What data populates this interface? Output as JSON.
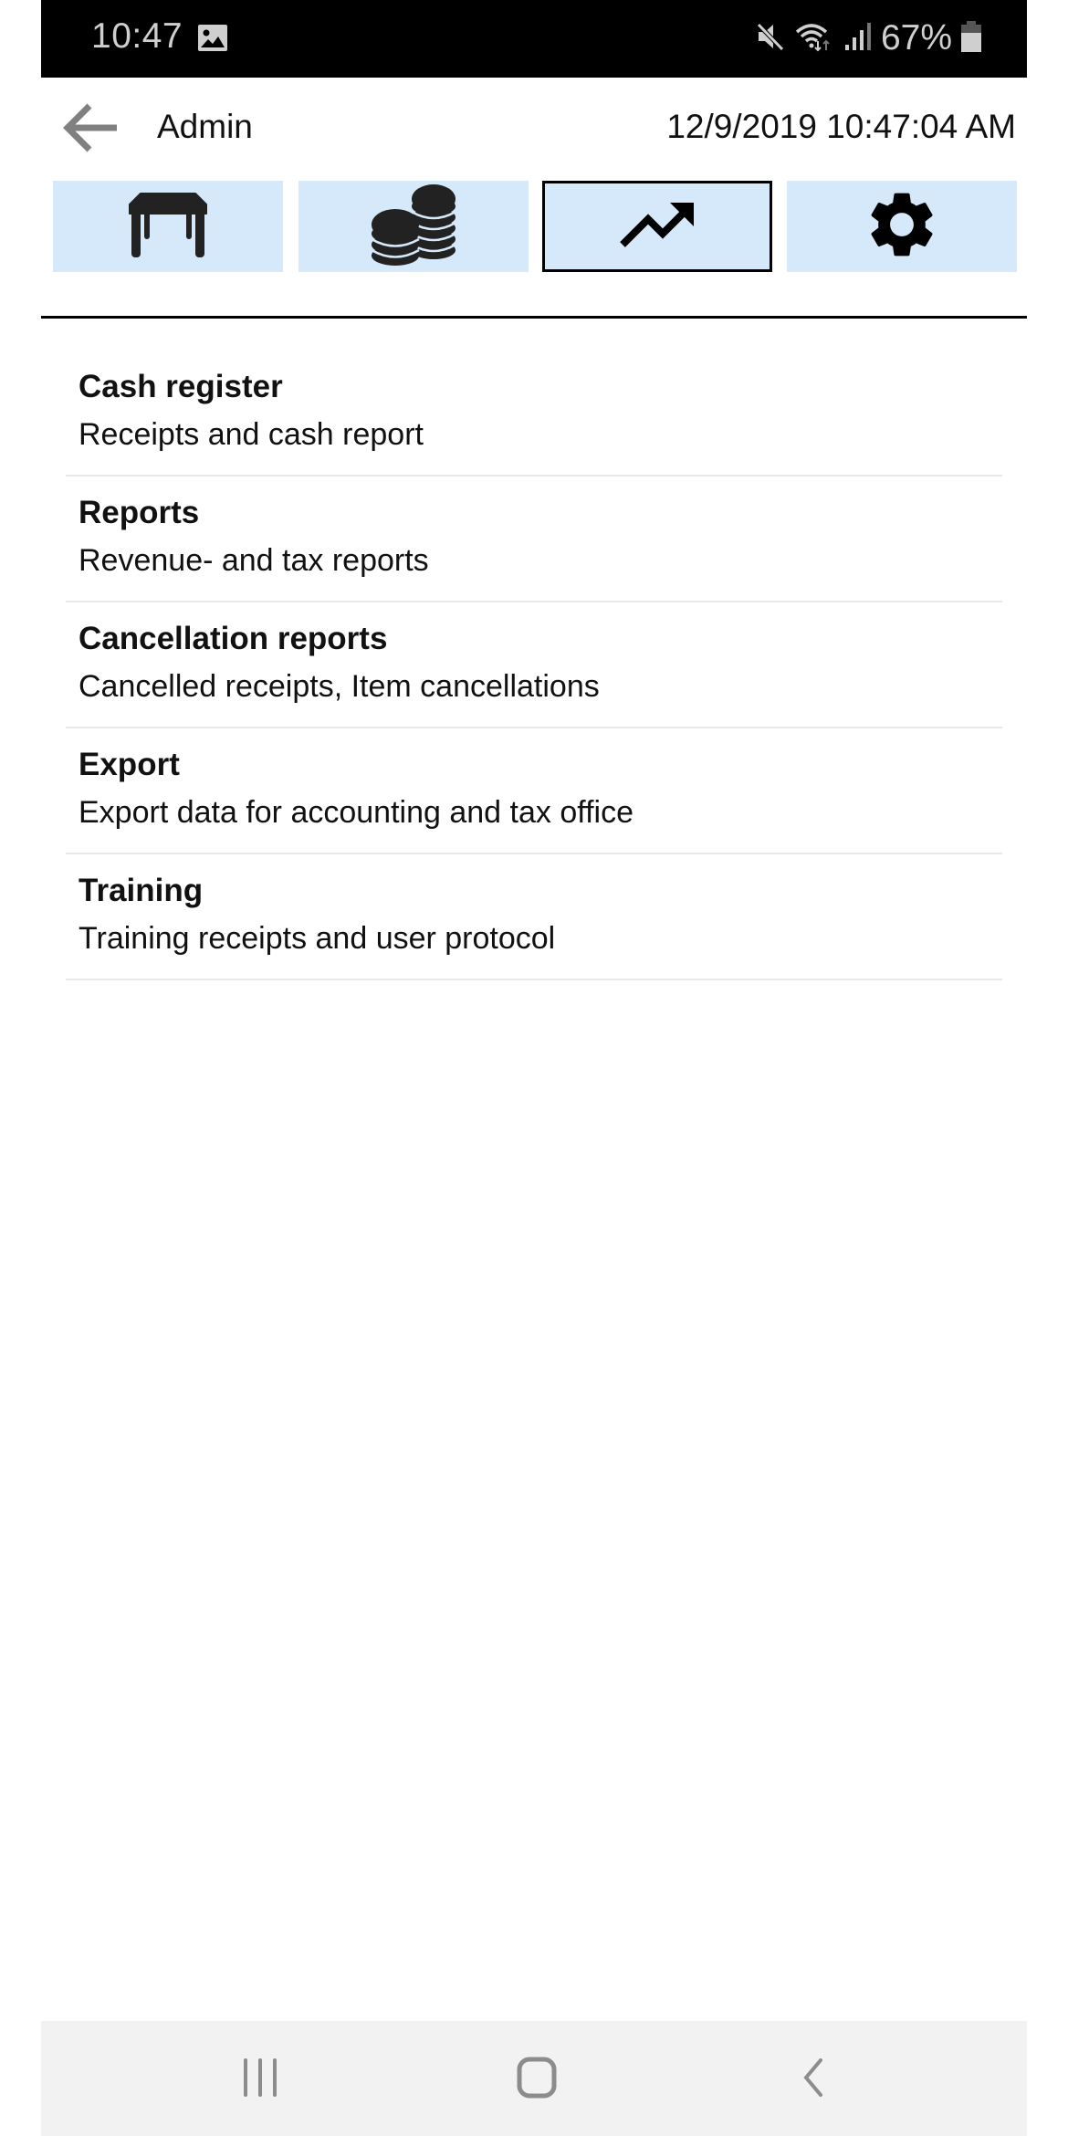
{
  "status_bar": {
    "time": "10:47",
    "notification_icon": "gallery-icon",
    "icons": [
      "mute-icon",
      "wifi-icon",
      "signal-icon"
    ],
    "battery_percent": "67%",
    "battery_icon": "battery-icon"
  },
  "header": {
    "back_icon": "arrow-left-icon",
    "title": "Admin",
    "datetime": "12/9/2019 10:47:04 AM"
  },
  "tabs": [
    {
      "icon": "table-icon",
      "name": "tables",
      "active": false
    },
    {
      "icon": "coins-icon",
      "name": "cash",
      "active": false
    },
    {
      "icon": "trending-up-icon",
      "name": "reports",
      "active": true
    },
    {
      "icon": "gear-icon",
      "name": "settings",
      "active": false
    }
  ],
  "colors": {
    "tile_background": "#d6e9fa",
    "active_border": "#000000",
    "nav_bar_background": "#f2f2f2"
  },
  "menu": {
    "items": [
      {
        "title": "Cash register",
        "subtitle": "Receipts and cash report"
      },
      {
        "title": "Reports",
        "subtitle": "Revenue- and tax reports"
      },
      {
        "title": "Cancellation reports",
        "subtitle": "Cancelled receipts, Item cancellations"
      },
      {
        "title": "Export",
        "subtitle": "Export data for accounting and tax office"
      },
      {
        "title": "Training",
        "subtitle": "Training receipts and user protocol"
      }
    ]
  },
  "nav_bar": {
    "buttons": [
      "recents-icon",
      "home-icon",
      "back-icon"
    ]
  }
}
